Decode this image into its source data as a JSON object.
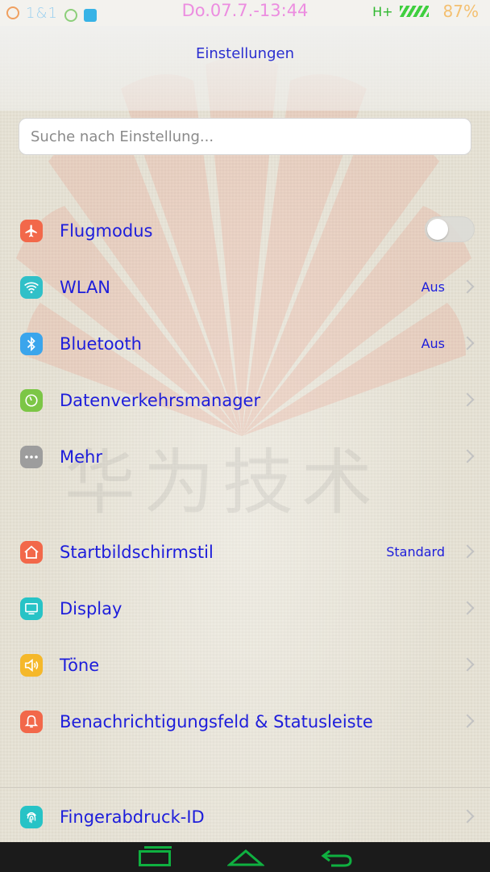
{
  "statusbar": {
    "carrier": "1&1",
    "datetime": "Do.07.7.-13:44",
    "network": "H+",
    "battery": "87%",
    "icons": [
      "alarm-icon",
      "clock-icon",
      "app-notification-icon",
      "signal-icon"
    ]
  },
  "header": {
    "title": "Einstellungen"
  },
  "search": {
    "placeholder": "Suche nach Einstellung..."
  },
  "watermark": "华为技术",
  "settings": [
    {
      "label": "Flugmodus",
      "icon": "airplane-icon",
      "color": "#f2684a",
      "control": "toggle",
      "toggle_on": false
    },
    {
      "label": "WLAN",
      "value": "Aus",
      "icon": "wifi-icon",
      "color": "#2fc0c8"
    },
    {
      "label": "Bluetooth",
      "value": "Aus",
      "icon": "bluetooth-icon",
      "color": "#3aa5ec"
    },
    {
      "label": "Datenverkehrsmanager",
      "icon": "data-usage-icon",
      "color": "#7cc646"
    },
    {
      "label": "Mehr",
      "icon": "more-icon",
      "color": "#9d9d9d"
    },
    {
      "label": "Startbildschirmstil",
      "value": "Standard",
      "icon": "home-icon",
      "color": "#f2684a"
    },
    {
      "label": "Display",
      "icon": "display-icon",
      "color": "#27c3c6"
    },
    {
      "label": "Töne",
      "icon": "sound-icon",
      "color": "#f5b82a"
    },
    {
      "label": "Benachrichtigungsfeld & Statusleiste",
      "icon": "notification-icon",
      "color": "#f2684a"
    },
    {
      "label": "Fingerabdruck-ID",
      "icon": "fingerprint-icon",
      "color": "#27c3c6"
    }
  ],
  "navbar": {
    "icons": [
      "recent-apps-icon",
      "home-nav-icon",
      "back-icon"
    ],
    "color": "#0fb040"
  }
}
